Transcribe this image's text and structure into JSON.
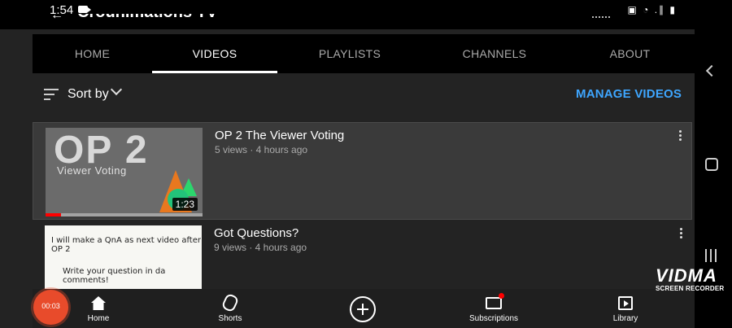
{
  "status_bar": {
    "time": "1:54",
    "right_icons": "▣ ◔ .∥ ▮"
  },
  "header": {
    "channel_title": "Crounimations TV"
  },
  "tabs": [
    {
      "label": "HOME",
      "active": false
    },
    {
      "label": "VIDEOS",
      "active": true
    },
    {
      "label": "PLAYLISTS",
      "active": false
    },
    {
      "label": "CHANNELS",
      "active": false
    },
    {
      "label": "ABOUT",
      "active": false
    }
  ],
  "sortbar": {
    "sort_label": "Sort by",
    "manage_label": "MANAGE VIDEOS"
  },
  "videos": [
    {
      "title": "OP 2 The Viewer Voting",
      "meta": "5 views · 4 hours ago",
      "duration": "1:23",
      "watched_fraction": 0.1,
      "thumb_title": "OP 2",
      "thumb_subtitle": "Viewer Voting"
    },
    {
      "title": "Got Questions?",
      "meta": "9 views · 4 hours ago",
      "thumb_line1": "I will make a QnA as next video after OP 2",
      "thumb_line2": "Write your question in da comments!"
    }
  ],
  "bottom_nav": [
    {
      "label": "Home",
      "icon": "home-icon"
    },
    {
      "label": "Shorts",
      "icon": "shorts-icon"
    },
    {
      "label": "",
      "icon": "create-icon"
    },
    {
      "label": "Subscriptions",
      "icon": "subscriptions-icon"
    },
    {
      "label": "Library",
      "icon": "library-icon"
    }
  ],
  "recorder": {
    "elapsed": "00:03"
  },
  "watermark": {
    "logo": "VIDMA",
    "subtitle": "SCREEN RECORDER"
  },
  "colors": {
    "accent_link": "#3ea6ff",
    "progress_red": "#ff0000",
    "recorder_orange": "#e84b2b"
  }
}
